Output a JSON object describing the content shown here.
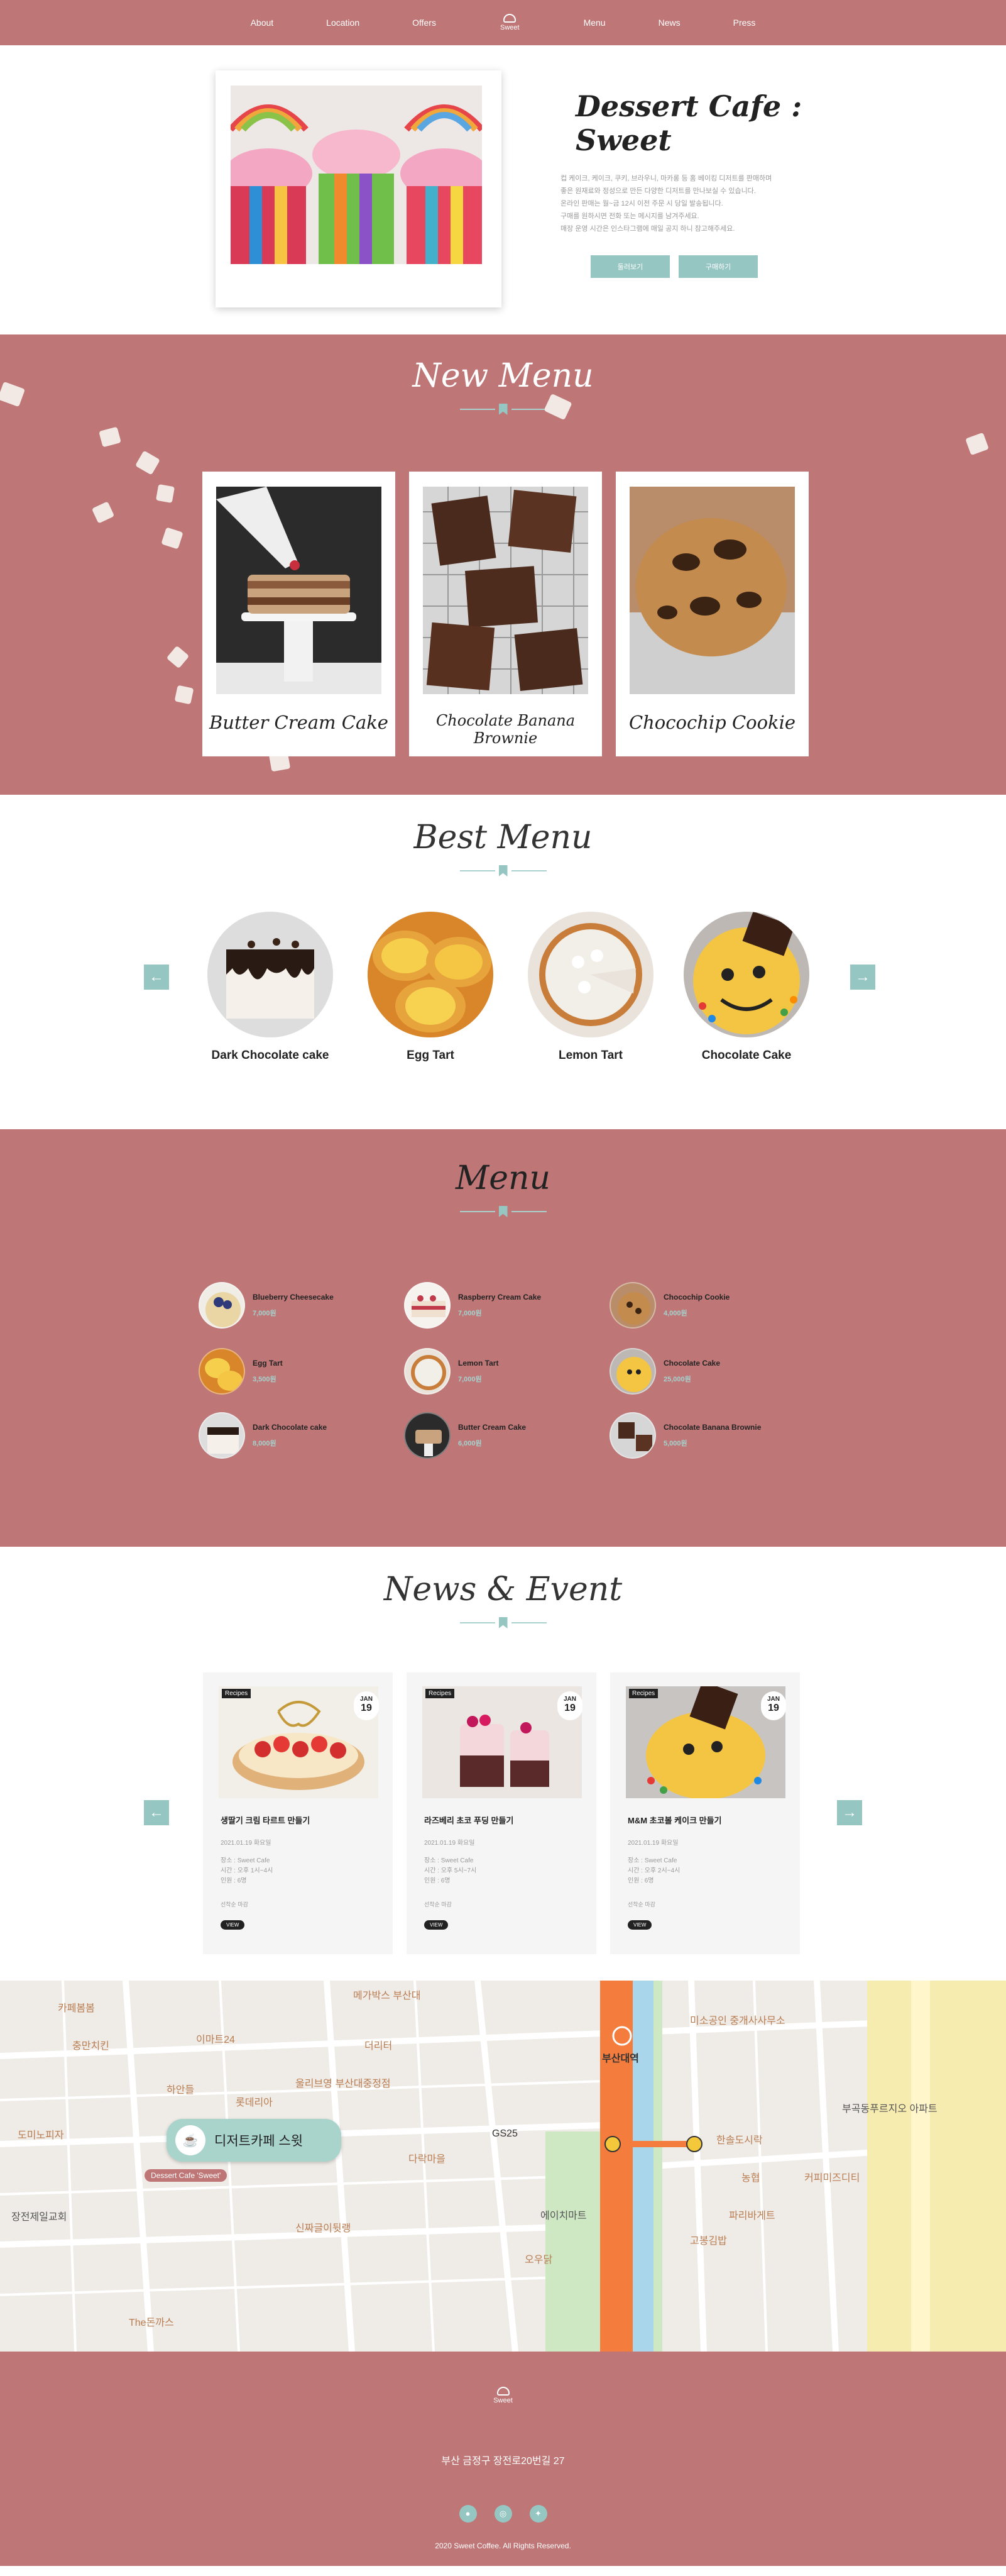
{
  "nav": {
    "left": [
      "About",
      "Location",
      "Offers"
    ],
    "right": [
      "Menu",
      "News",
      "Press"
    ],
    "logo": "Sweet"
  },
  "intro": {
    "title": "Dessert Cafe : Sweet",
    "desc": [
      "컵 케이크, 케이크, 쿠키, 브라우니, 마카롱 등 홈 베이킹 디저트를 판매하며",
      "좋은 원재료와 정성으로 만든 다양한 디저트를 만나보실 수 있습니다.",
      "온라인 판매는 월~금 12시 이전 주문 시 당일 발송됩니다.",
      "구매를 원하시면 전화 또는 메시지를 남겨주세요.",
      "매장 운영 시간은 인스타그램에 매일 공지 하니 참고해주세요."
    ],
    "btn_more": "둘러보기",
    "btn_buy": "구매하기"
  },
  "new_menu": {
    "title": "New Menu",
    "items": [
      "Butter Cream Cake",
      "Chocolate Banana Brownie",
      "Chocochip Cookie"
    ]
  },
  "best_menu": {
    "title": "Best Menu",
    "items": [
      "Dark Chocolate cake",
      "Egg Tart",
      "Lemon Tart",
      "Chocolate Cake"
    ],
    "prev": "←",
    "next": "→"
  },
  "menu": {
    "title": "Menu",
    "items": [
      {
        "name": "Blueberry Cheesecake",
        "price": "7,000원"
      },
      {
        "name": "Raspberry Cream Cake",
        "price": "7,000원"
      },
      {
        "name": "Chocochip Cookie",
        "price": "4,000원"
      },
      {
        "name": "Egg Tart",
        "price": "3,500원"
      },
      {
        "name": "Lemon Tart",
        "price": "7,000원"
      },
      {
        "name": "Chocolate Cake",
        "price": "25,000원"
      },
      {
        "name": "Dark Chocolate cake",
        "price": "8,000원"
      },
      {
        "name": "Butter Cream Cake",
        "price": "6,000원"
      },
      {
        "name": "Chocolate Banana Brownie",
        "price": "5,000원"
      }
    ]
  },
  "news": {
    "title": "News & Event",
    "cards": [
      {
        "tag": "Recipes",
        "mon": "JAN",
        "day": "19",
        "title": "생딸기 크림 타르트 만들기",
        "date": "2021.01.19 화요일",
        "place": "장소 : Sweet Cafe",
        "time": "시간 : 오후 1시~4시",
        "people": "인원 : 6명",
        "cat": "선착순 마감",
        "more": "VIEW"
      },
      {
        "tag": "Recipes",
        "mon": "JAN",
        "day": "19",
        "title": "라즈베리 초코 푸딩 만들기",
        "date": "2021.01.19 화요일",
        "place": "장소 : Sweet Cafe",
        "time": "시간 : 오후 5시~7시",
        "people": "인원 : 6명",
        "cat": "선착순 마감",
        "more": "VIEW"
      },
      {
        "tag": "Recipes",
        "mon": "JAN",
        "day": "19",
        "title": "M&M 초코볼 케이크 만들기",
        "date": "2021.01.19 화요일",
        "place": "장소 : Sweet Cafe",
        "time": "시간 : 오후 2시~4시",
        "people": "인원 : 6명",
        "cat": "선착순 마감",
        "more": "VIEW"
      }
    ],
    "prev": "←",
    "next": "→"
  },
  "map": {
    "bubble": "디저트카페 스윗",
    "tag": "Dessert Cafe 'Sweet'",
    "labels": [
      "카페봄봄",
      "이마트24",
      "충만치킨",
      "메가박스 부산대",
      "더리터",
      "미소공인 중개사사무소",
      "부산대역",
      "하안들",
      "롯데리아",
      "울리브영 부산대중정점",
      "GS25",
      "부곡동푸르지오 아파트",
      "한솔도시락",
      "다락마을",
      "에이치마트",
      "고봉김밥",
      "도미노피자",
      "장전제일교회",
      "신짜글이뒷랭",
      "The돈까스",
      "오우닭",
      "커피미즈디티",
      "농협",
      "파리바게트"
    ]
  },
  "footer": {
    "logo": "Sweet",
    "address": "부산 금정구 장전로20번길 27",
    "social": [
      "●",
      "◎",
      "✦"
    ],
    "copyright": "2020 Sweet Coffee. All Rights Reserved."
  }
}
